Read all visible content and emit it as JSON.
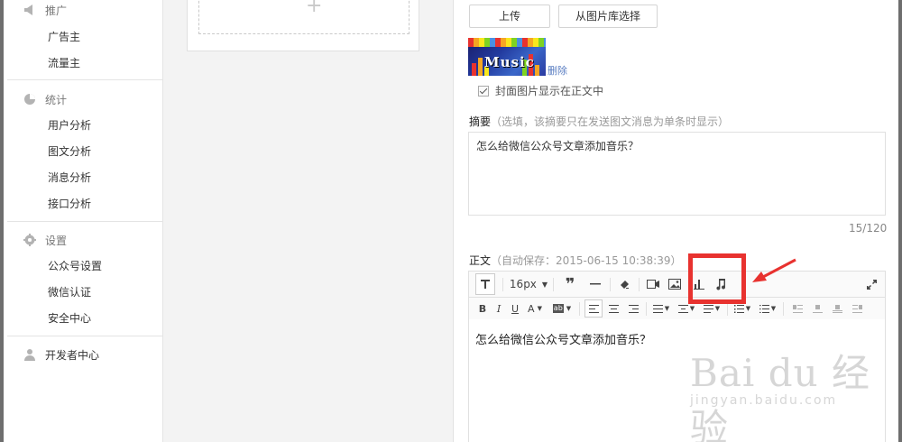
{
  "sidebar": {
    "groups": [
      {
        "title": "推广",
        "icon": "megaphone-icon",
        "items": [
          "广告主",
          "流量主"
        ]
      },
      {
        "title": "统计",
        "icon": "pie-chart-icon",
        "items": [
          "用户分析",
          "图文分析",
          "消息分析",
          "接口分析"
        ]
      },
      {
        "title": "设置",
        "icon": "gear-icon",
        "items": [
          "公众号设置",
          "微信认证",
          "安全中心"
        ]
      },
      {
        "title": "开发者中心",
        "icon": "user-icon",
        "items": []
      }
    ]
  },
  "cover": {
    "upload_label": "上传",
    "library_label": "从图片库选择",
    "thumbnail_text": "Music",
    "delete_label": "删除",
    "show_in_body_label": "封面图片显示在正文中",
    "show_in_body_checked": true
  },
  "summary": {
    "label": "摘要",
    "hint": "（选填，该摘要只在发送图文消息为单条时显示）",
    "value": "怎么给微信公众号文章添加音乐？",
    "counter": "15/120"
  },
  "body": {
    "label": "正文",
    "autosave": "（自动保存：2015-06-15 10:38:39）",
    "font_size": "16px",
    "content": "怎么给微信公众号文章添加音乐？"
  },
  "watermark": {
    "main": "Bai du 经验",
    "sub": "jingyan.baidu.com"
  },
  "colors": {
    "highlight": "#e8322f",
    "link": "#5a7ec2"
  }
}
